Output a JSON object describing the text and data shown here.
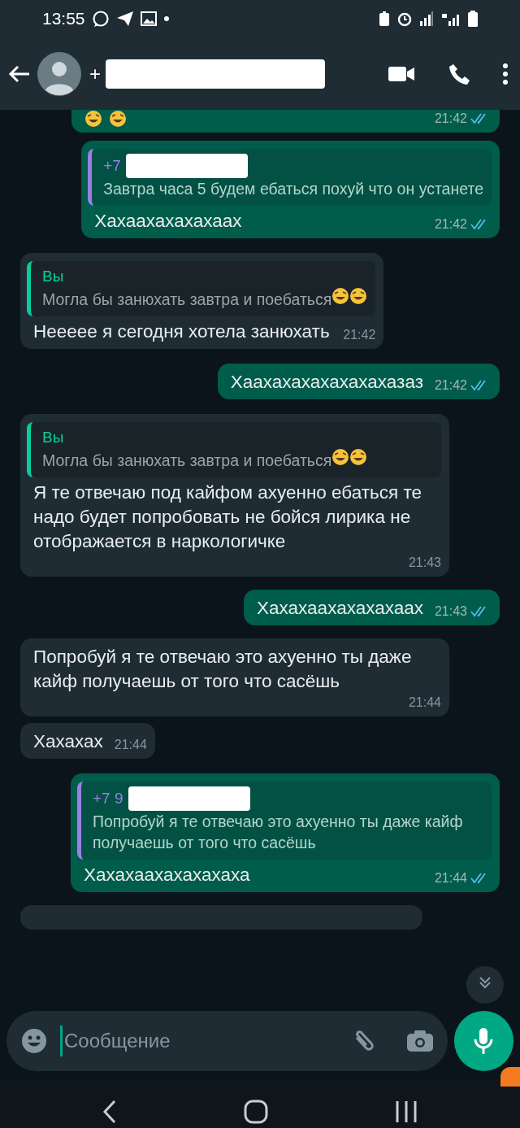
{
  "status_bar": {
    "time": "13:55"
  },
  "header": {
    "name": "+",
    "name_redacted": true
  },
  "messages": [
    {
      "kind": "outgoing",
      "trailing_emoji": true,
      "time": "21:42",
      "read": true
    },
    {
      "kind": "outgoing",
      "quote": {
        "author": "+7",
        "author_redacted": true,
        "text": "Завтра часа 5 будем ебаться похуй что он устанете",
        "color": "#9b7fe6",
        "trailing_emoji": false
      },
      "text": "Хахаахахахахаах",
      "time": "21:42",
      "read": true
    },
    {
      "kind": "incoming",
      "quote": {
        "author": "Вы",
        "author_redacted": false,
        "text": "Могла бы занюхать завтра и поебаться",
        "color": "#06cf9c",
        "trailing_emoji": true
      },
      "text": "Неееее я сегодня хотела занюхать",
      "time": "21:42"
    },
    {
      "kind": "outgoing",
      "text": "Хаахахахахахахахазаз",
      "time": "21:42",
      "read": true
    },
    {
      "kind": "incoming",
      "quote": {
        "author": "Вы",
        "author_redacted": false,
        "text": "Могла бы занюхать завтра и поебаться",
        "color": "#06cf9c",
        "trailing_emoji": true
      },
      "text": "Я те отвечаю под кайфом ахуенно ебаться те надо будет попробовать не бойся лирика не отображается в наркологичке",
      "time": "21:43"
    },
    {
      "kind": "outgoing",
      "text": "Хахахаахахахахаах",
      "time": "21:43",
      "read": true
    },
    {
      "kind": "incoming",
      "text": "Попробуй я те отвечаю это ахуенно ты даже кайф получаешь от того что сасёшь",
      "time": "21:44"
    },
    {
      "kind": "incoming",
      "text": "Хахахах",
      "time": "21:44"
    },
    {
      "kind": "outgoing",
      "quote": {
        "author": "+7 9",
        "author_redacted": true,
        "text": "Попробуй я те отвечаю это ахуенно ты даже кайф получаешь от того что сасёшь",
        "color": "#9b7fe6",
        "trailing_emoji": false
      },
      "text": "Хахахаахахахахаха",
      "time": "21:44",
      "read": true
    }
  ],
  "composer": {
    "placeholder": "Сообщение"
  }
}
